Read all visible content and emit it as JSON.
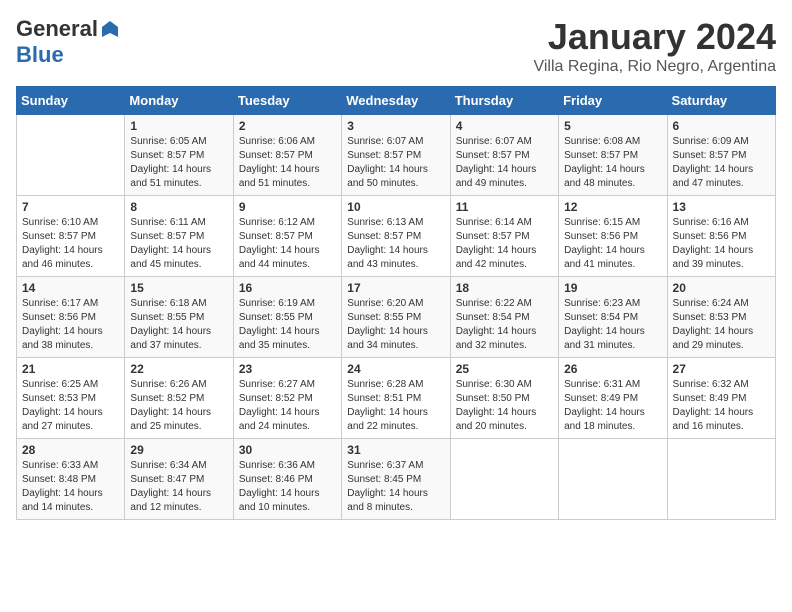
{
  "header": {
    "logo_general": "General",
    "logo_blue": "Blue",
    "title": "January 2024",
    "subtitle": "Villa Regina, Rio Negro, Argentina"
  },
  "calendar": {
    "days_of_week": [
      "Sunday",
      "Monday",
      "Tuesday",
      "Wednesday",
      "Thursday",
      "Friday",
      "Saturday"
    ],
    "weeks": [
      [
        {
          "day": "",
          "sunrise": "",
          "sunset": "",
          "daylight": ""
        },
        {
          "day": "1",
          "sunrise": "Sunrise: 6:05 AM",
          "sunset": "Sunset: 8:57 PM",
          "daylight": "Daylight: 14 hours and 51 minutes."
        },
        {
          "day": "2",
          "sunrise": "Sunrise: 6:06 AM",
          "sunset": "Sunset: 8:57 PM",
          "daylight": "Daylight: 14 hours and 51 minutes."
        },
        {
          "day": "3",
          "sunrise": "Sunrise: 6:07 AM",
          "sunset": "Sunset: 8:57 PM",
          "daylight": "Daylight: 14 hours and 50 minutes."
        },
        {
          "day": "4",
          "sunrise": "Sunrise: 6:07 AM",
          "sunset": "Sunset: 8:57 PM",
          "daylight": "Daylight: 14 hours and 49 minutes."
        },
        {
          "day": "5",
          "sunrise": "Sunrise: 6:08 AM",
          "sunset": "Sunset: 8:57 PM",
          "daylight": "Daylight: 14 hours and 48 minutes."
        },
        {
          "day": "6",
          "sunrise": "Sunrise: 6:09 AM",
          "sunset": "Sunset: 8:57 PM",
          "daylight": "Daylight: 14 hours and 47 minutes."
        }
      ],
      [
        {
          "day": "7",
          "sunrise": "Sunrise: 6:10 AM",
          "sunset": "Sunset: 8:57 PM",
          "daylight": "Daylight: 14 hours and 46 minutes."
        },
        {
          "day": "8",
          "sunrise": "Sunrise: 6:11 AM",
          "sunset": "Sunset: 8:57 PM",
          "daylight": "Daylight: 14 hours and 45 minutes."
        },
        {
          "day": "9",
          "sunrise": "Sunrise: 6:12 AM",
          "sunset": "Sunset: 8:57 PM",
          "daylight": "Daylight: 14 hours and 44 minutes."
        },
        {
          "day": "10",
          "sunrise": "Sunrise: 6:13 AM",
          "sunset": "Sunset: 8:57 PM",
          "daylight": "Daylight: 14 hours and 43 minutes."
        },
        {
          "day": "11",
          "sunrise": "Sunrise: 6:14 AM",
          "sunset": "Sunset: 8:57 PM",
          "daylight": "Daylight: 14 hours and 42 minutes."
        },
        {
          "day": "12",
          "sunrise": "Sunrise: 6:15 AM",
          "sunset": "Sunset: 8:56 PM",
          "daylight": "Daylight: 14 hours and 41 minutes."
        },
        {
          "day": "13",
          "sunrise": "Sunrise: 6:16 AM",
          "sunset": "Sunset: 8:56 PM",
          "daylight": "Daylight: 14 hours and 39 minutes."
        }
      ],
      [
        {
          "day": "14",
          "sunrise": "Sunrise: 6:17 AM",
          "sunset": "Sunset: 8:56 PM",
          "daylight": "Daylight: 14 hours and 38 minutes."
        },
        {
          "day": "15",
          "sunrise": "Sunrise: 6:18 AM",
          "sunset": "Sunset: 8:55 PM",
          "daylight": "Daylight: 14 hours and 37 minutes."
        },
        {
          "day": "16",
          "sunrise": "Sunrise: 6:19 AM",
          "sunset": "Sunset: 8:55 PM",
          "daylight": "Daylight: 14 hours and 35 minutes."
        },
        {
          "day": "17",
          "sunrise": "Sunrise: 6:20 AM",
          "sunset": "Sunset: 8:55 PM",
          "daylight": "Daylight: 14 hours and 34 minutes."
        },
        {
          "day": "18",
          "sunrise": "Sunrise: 6:22 AM",
          "sunset": "Sunset: 8:54 PM",
          "daylight": "Daylight: 14 hours and 32 minutes."
        },
        {
          "day": "19",
          "sunrise": "Sunrise: 6:23 AM",
          "sunset": "Sunset: 8:54 PM",
          "daylight": "Daylight: 14 hours and 31 minutes."
        },
        {
          "day": "20",
          "sunrise": "Sunrise: 6:24 AM",
          "sunset": "Sunset: 8:53 PM",
          "daylight": "Daylight: 14 hours and 29 minutes."
        }
      ],
      [
        {
          "day": "21",
          "sunrise": "Sunrise: 6:25 AM",
          "sunset": "Sunset: 8:53 PM",
          "daylight": "Daylight: 14 hours and 27 minutes."
        },
        {
          "day": "22",
          "sunrise": "Sunrise: 6:26 AM",
          "sunset": "Sunset: 8:52 PM",
          "daylight": "Daylight: 14 hours and 25 minutes."
        },
        {
          "day": "23",
          "sunrise": "Sunrise: 6:27 AM",
          "sunset": "Sunset: 8:52 PM",
          "daylight": "Daylight: 14 hours and 24 minutes."
        },
        {
          "day": "24",
          "sunrise": "Sunrise: 6:28 AM",
          "sunset": "Sunset: 8:51 PM",
          "daylight": "Daylight: 14 hours and 22 minutes."
        },
        {
          "day": "25",
          "sunrise": "Sunrise: 6:30 AM",
          "sunset": "Sunset: 8:50 PM",
          "daylight": "Daylight: 14 hours and 20 minutes."
        },
        {
          "day": "26",
          "sunrise": "Sunrise: 6:31 AM",
          "sunset": "Sunset: 8:49 PM",
          "daylight": "Daylight: 14 hours and 18 minutes."
        },
        {
          "day": "27",
          "sunrise": "Sunrise: 6:32 AM",
          "sunset": "Sunset: 8:49 PM",
          "daylight": "Daylight: 14 hours and 16 minutes."
        }
      ],
      [
        {
          "day": "28",
          "sunrise": "Sunrise: 6:33 AM",
          "sunset": "Sunset: 8:48 PM",
          "daylight": "Daylight: 14 hours and 14 minutes."
        },
        {
          "day": "29",
          "sunrise": "Sunrise: 6:34 AM",
          "sunset": "Sunset: 8:47 PM",
          "daylight": "Daylight: 14 hours and 12 minutes."
        },
        {
          "day": "30",
          "sunrise": "Sunrise: 6:36 AM",
          "sunset": "Sunset: 8:46 PM",
          "daylight": "Daylight: 14 hours and 10 minutes."
        },
        {
          "day": "31",
          "sunrise": "Sunrise: 6:37 AM",
          "sunset": "Sunset: 8:45 PM",
          "daylight": "Daylight: 14 hours and 8 minutes."
        },
        {
          "day": "",
          "sunrise": "",
          "sunset": "",
          "daylight": ""
        },
        {
          "day": "",
          "sunrise": "",
          "sunset": "",
          "daylight": ""
        },
        {
          "day": "",
          "sunrise": "",
          "sunset": "",
          "daylight": ""
        }
      ]
    ]
  }
}
